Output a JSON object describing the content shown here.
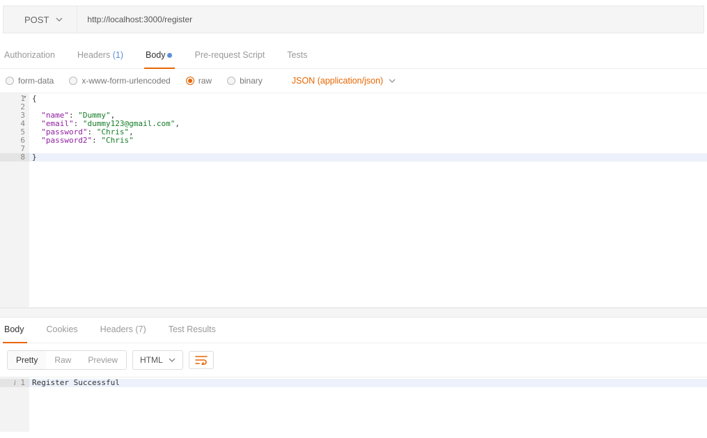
{
  "request": {
    "method": "POST",
    "url": "http://localhost:3000/register"
  },
  "tabs": {
    "auth": "Authorization",
    "headers": "Headers",
    "headers_count": "(1)",
    "body": "Body",
    "prereq": "Pre-request Script",
    "tests": "Tests"
  },
  "body_opts": {
    "formdata": "form-data",
    "urlencoded": "x-www-form-urlencoded",
    "raw": "raw",
    "binary": "binary",
    "type": "JSON (application/json)"
  },
  "editor": {
    "l1": "{",
    "l2": "",
    "l3_k": "\"name\"",
    "l3_v": "\"Dummy\"",
    "l4_k": "\"email\"",
    "l4_v": "\"dummy123@gmail.com\"",
    "l5_k": "\"password\"",
    "l5_v": "\"Chris\"",
    "l6_k": "\"password2\"",
    "l6_v": "\"Chris\"",
    "l7": "",
    "l8": "}",
    "lines": [
      "1",
      "2",
      "3",
      "4",
      "5",
      "6",
      "7",
      "8"
    ]
  },
  "resp_tabs": {
    "body": "Body",
    "cookies": "Cookies",
    "headers": "Headers",
    "headers_count": "(7)",
    "tests": "Test Results"
  },
  "resp_toolbar": {
    "pretty": "Pretty",
    "raw": "Raw",
    "preview": "Preview",
    "format": "HTML"
  },
  "response": {
    "ln1": "1",
    "text": "Register Successful"
  }
}
